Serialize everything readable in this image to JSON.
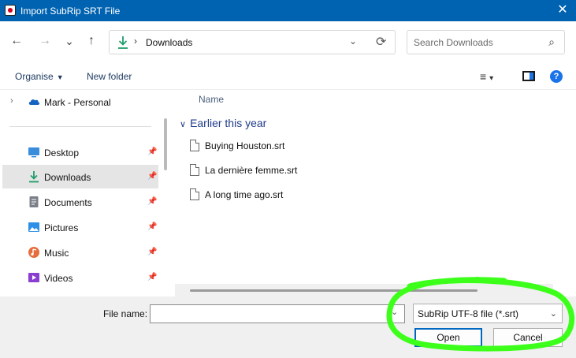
{
  "window": {
    "title": "Import SubRip SRT File",
    "close_glyph": "✕"
  },
  "nav": {
    "back_icon": "←",
    "forward_icon": "→",
    "recent_icon": "⌄",
    "up_icon": "↑",
    "address": {
      "separator": "›",
      "location": "Downloads",
      "dropdown_icon": "⌄",
      "refresh_icon": "⟳"
    },
    "search": {
      "placeholder": "Search Downloads",
      "icon": "⌕"
    }
  },
  "commands": {
    "organise": "Organise",
    "organise_caret": "▼",
    "new_folder": "New folder",
    "view_icon": "≡",
    "view_caret": "▾",
    "help_glyph": "?"
  },
  "sidebar": {
    "root": {
      "expand_icon": "›",
      "label": "Mark - Personal",
      "icon": "cloud-icon"
    },
    "pin_glyph": "📌",
    "items": [
      {
        "label": "Desktop",
        "icon": "desktop-icon",
        "color": "#3a8ddb"
      },
      {
        "label": "Downloads",
        "icon": "download-icon",
        "color": "#1e9e6a",
        "selected": true
      },
      {
        "label": "Documents",
        "icon": "documents-icon",
        "color": "#7a7f88"
      },
      {
        "label": "Pictures",
        "icon": "pictures-icon",
        "color": "#2d8fe6"
      },
      {
        "label": "Music",
        "icon": "music-icon",
        "color": "#e66e3d"
      },
      {
        "label": "Videos",
        "icon": "videos-icon",
        "color": "#8a3fd1"
      }
    ]
  },
  "content": {
    "column_header": "Name",
    "group": {
      "chevron": "∨",
      "label": "Earlier this year"
    },
    "files": [
      "Buying Houston.srt",
      "La dernière femme.srt",
      "A long time ago.srt"
    ]
  },
  "footer": {
    "file_name_label": "File name:",
    "file_name_value": "",
    "file_name_drop": "⌄",
    "file_type": "SubRip UTF-8 file (*.srt)",
    "file_type_caret": "⌄",
    "open_label": "Open",
    "cancel_label": "Cancel"
  },
  "colors": {
    "title_bar": "#0063b1",
    "accent": "#0067c0",
    "highlight": "#3cff1a"
  }
}
